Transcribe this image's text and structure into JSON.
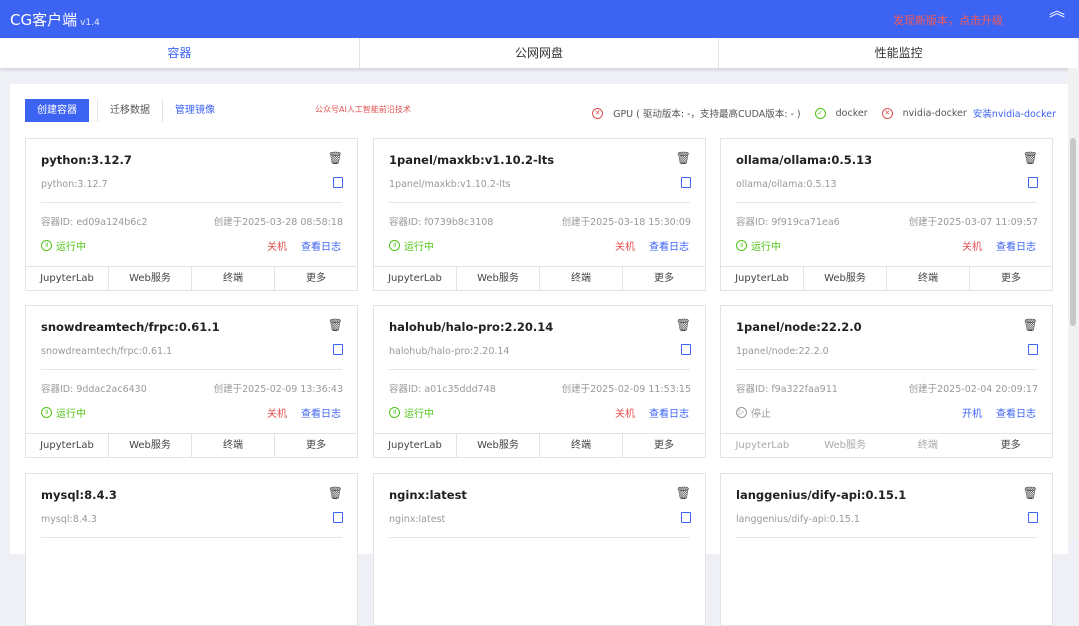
{
  "header": {
    "title": "CG客户端",
    "version": "v1.4",
    "upgrade": "发现新版本，点击升级",
    "collapse_icon": "︽"
  },
  "tabs": [
    {
      "label": "容器"
    },
    {
      "label": "公网网盘"
    },
    {
      "label": "性能监控"
    }
  ],
  "toolbar": {
    "create": "创建容器",
    "migrate": "迁移数据",
    "images": "管理镜像",
    "note": "公众号AI人工智能前沿技术"
  },
  "env": {
    "gpu": "GPU ( 驱动版本: -，支持最高CUDA版本: - )",
    "docker": "docker",
    "nvidia": "nvidia-docker",
    "install": "安装nvidia-docker"
  },
  "footer_labels": [
    "JupyterLab",
    "Web服务",
    "终端",
    "更多"
  ],
  "containers": [
    {
      "name": "python:3.12.7",
      "image": "python:3.12.7",
      "id": "容器ID: ed09a124b6c2",
      "created": "创建于2025-03-28 08:58:18",
      "status": "运行中",
      "power": "关机",
      "logs": "查看日志"
    },
    {
      "name": "1panel/maxkb:v1.10.2-lts",
      "image": "1panel/maxkb:v1.10.2-lts",
      "id": "容器ID: f0739b8c3108",
      "created": "创建于2025-03-18 15:30:09",
      "status": "运行中",
      "power": "关机",
      "logs": "查看日志"
    },
    {
      "name": "ollama/ollama:0.5.13",
      "image": "ollama/ollama:0.5.13",
      "id": "容器ID: 9f919ca71ea6",
      "created": "创建于2025-03-07 11:09:57",
      "status": "运行中",
      "power": "关机",
      "logs": "查看日志"
    },
    {
      "name": "snowdreamtech/frpc:0.61.1",
      "image": "snowdreamtech/frpc:0.61.1",
      "id": "容器ID: 9ddac2ac6430",
      "created": "创建于2025-02-09 13:36:43",
      "status": "运行中",
      "power": "关机",
      "logs": "查看日志"
    },
    {
      "name": "halohub/halo-pro:2.20.14",
      "image": "halohub/halo-pro:2.20.14",
      "id": "容器ID: a01c35ddd748",
      "created": "创建于2025-02-09 11:53:15",
      "status": "运行中",
      "power": "关机",
      "logs": "查看日志"
    },
    {
      "name": "1panel/node:22.2.0",
      "image": "1panel/node:22.2.0",
      "id": "容器ID: f9a322faa911",
      "created": "创建于2025-02-04 20:09:17",
      "status": "停止",
      "power": "开机",
      "logs": "查看日志"
    },
    {
      "name": "mysql:8.4.3",
      "image": "mysql:8.4.3"
    },
    {
      "name": "nginx:latest",
      "image": "nginx:latest"
    },
    {
      "name": "langgenius/dify-api:0.15.1",
      "image": "langgenius/dify-api:0.15.1"
    }
  ]
}
